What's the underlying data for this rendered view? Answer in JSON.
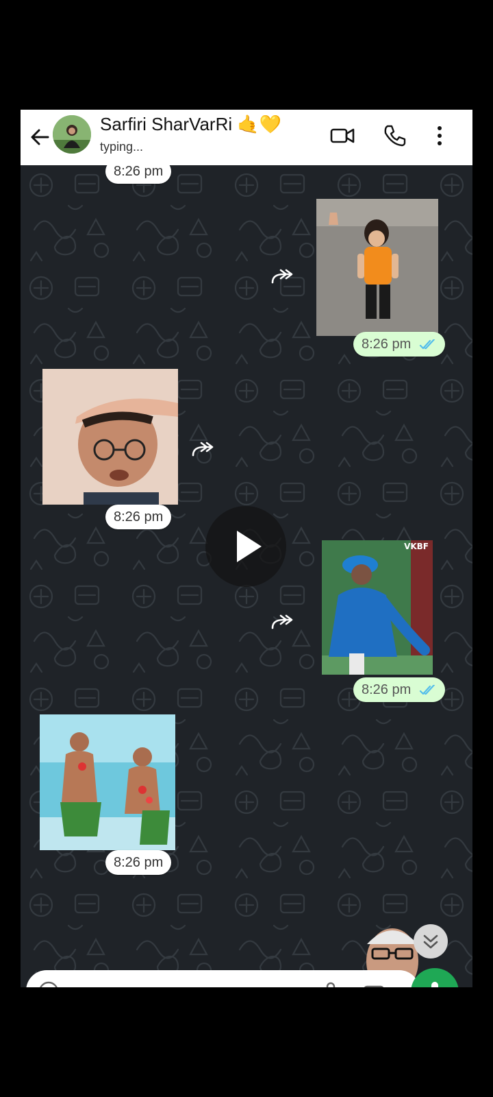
{
  "header": {
    "contact_name": "Sarfiri SharVarRi 🤙💛",
    "status": "typing...",
    "icons": [
      "back-arrow-icon",
      "video-call-icon",
      "voice-call-icon",
      "more-options-icon"
    ]
  },
  "messages": [
    {
      "direction": "in",
      "time": "8:26 pm"
    },
    {
      "direction": "out",
      "time": "8:26 pm",
      "sticker": "toddler-walking-sticker"
    },
    {
      "direction": "in",
      "time": "8:26 pm",
      "sticker": "man-saluting-sticker"
    },
    {
      "direction": "out",
      "time": "8:26 pm",
      "sticker": "cricketer-sticker",
      "sticker_text": "VKBF"
    },
    {
      "direction": "in",
      "time": "8:26 pm",
      "sticker": "beach-dancers-sticker"
    }
  ],
  "colors": {
    "chat_bg": "#1f2328",
    "incoming_bubble": "#ffffff",
    "outgoing_bubble": "#d9fdd3",
    "read_ticks": "#53bdeb",
    "mic_button": "#1fa855"
  }
}
